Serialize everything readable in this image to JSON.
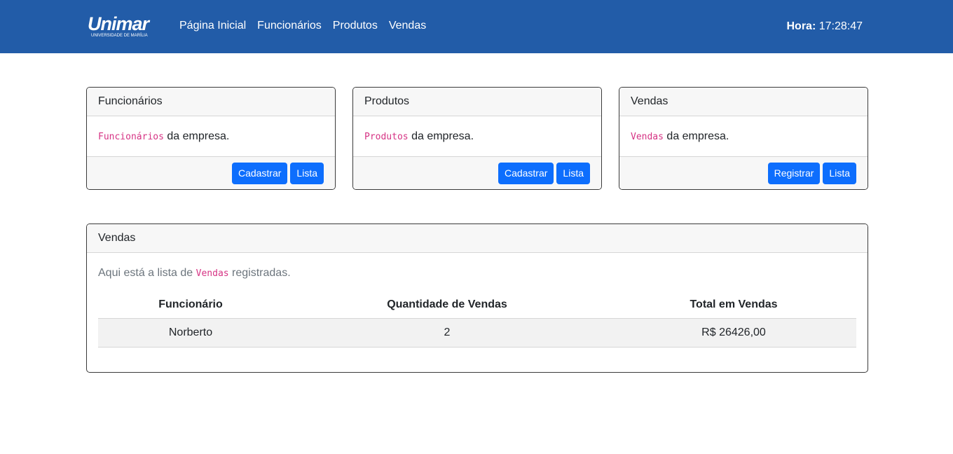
{
  "navbar": {
    "brand": "Unimar",
    "brand_sub": "UNIVERSIDADE DE MARÍLIA",
    "links": [
      "Página Inicial",
      "Funcionários",
      "Produtos",
      "Vendas"
    ],
    "clock_label": "Hora:",
    "clock_value": "17:28:47"
  },
  "cards": [
    {
      "title": "Funcionários",
      "code": "Funcionários",
      "text": " da empresa.",
      "buttons": [
        "Cadastrar",
        "Lista"
      ]
    },
    {
      "title": "Produtos",
      "code": "Produtos",
      "text": " da empresa.",
      "buttons": [
        "Cadastrar",
        "Lista"
      ]
    },
    {
      "title": "Vendas",
      "code": "Vendas",
      "text": " da empresa.",
      "buttons": [
        "Registrar",
        "Lista"
      ]
    }
  ],
  "sales": {
    "title": "Vendas",
    "lead_prefix": "Aqui está a lista de ",
    "lead_code": "Vendas",
    "lead_suffix": " registradas.",
    "columns": [
      "Funcionário",
      "Quantidade de Vendas",
      "Total em Vendas"
    ],
    "rows": [
      [
        "Norberto",
        "2",
        "R$ 26426,00"
      ]
    ]
  },
  "colors": {
    "navbar": "#225ca8",
    "button": "#0d6efd",
    "code": "#d63384"
  }
}
